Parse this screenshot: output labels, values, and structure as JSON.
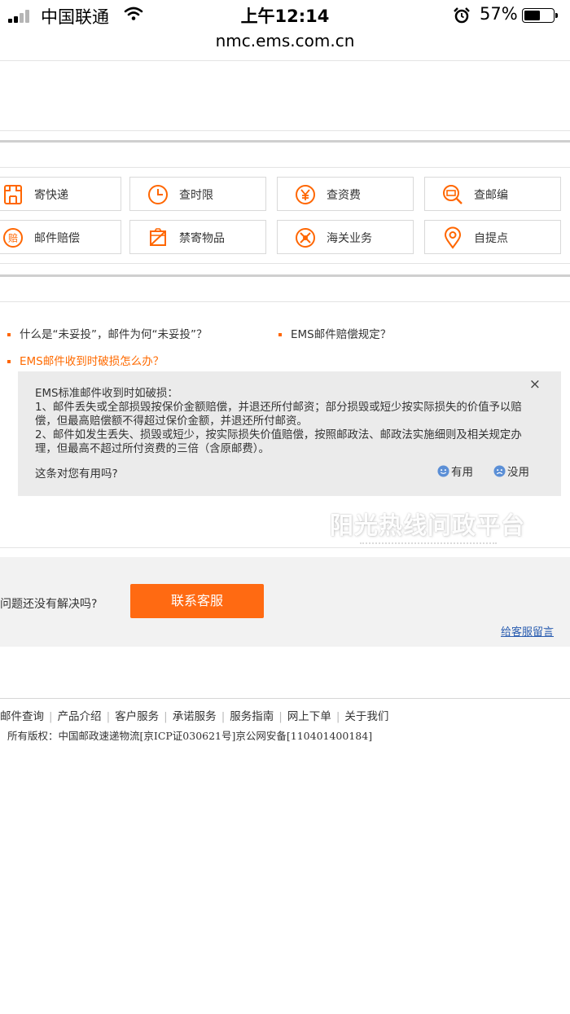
{
  "status_bar": {
    "carrier": "中国联通",
    "time": "上午12:14",
    "battery": "57%",
    "battery_level": 0.57
  },
  "browser": {
    "url": "nmc.ems.com.cn"
  },
  "services": [
    {
      "label": "寄快递",
      "icon": "package-icon"
    },
    {
      "label": "查时限",
      "icon": "clock-icon"
    },
    {
      "label": "查资费",
      "icon": "yen-icon"
    },
    {
      "label": "查邮编",
      "icon": "postcode-search-icon"
    },
    {
      "label": "邮件赔偿",
      "icon": "compensation-icon"
    },
    {
      "label": "禁寄物品",
      "icon": "prohibited-items-icon"
    },
    {
      "label": "海关业务",
      "icon": "customs-icon"
    },
    {
      "label": "自提点",
      "icon": "location-pin-icon"
    }
  ],
  "faq": {
    "items": [
      "什么是“未妥投”，邮件为何“未妥投”？",
      "EMS邮件赔偿规定？",
      "EMS邮件收到时破损怎么办？"
    ],
    "answer": {
      "lines": [
        "EMS标准邮件收到时如破损：",
        "1、邮件丢失或全部损毁按保价金额赔偿，并退还所付邮资；部分损毁或短少按实际损失的价值予以赔偿，但最高赔偿额不得超过保价金额，并退还所付邮资。",
        "2、邮件如发生丢失、损毁或短少，按实际损失价值赔偿，按照邮政法、邮政法实施细则及相关规定办理，但最高不超过所付资费的三倍（含原邮费）。"
      ],
      "close": "×",
      "helpful_question": "这条对您有用吗?",
      "yes": "有用",
      "no": "没用"
    }
  },
  "watermark": "阳光热线问政平台",
  "contact": {
    "question": "问题还没有解决吗?",
    "button": "联系客服",
    "message_link": "给客服留言"
  },
  "footer": {
    "links": [
      "邮件查询",
      "产品介绍",
      "客户服务",
      "承诺服务",
      "服务指南",
      "网上下单",
      "关于我们"
    ],
    "copyright": "所有版权：中国邮政速递物流[京ICP证030621号]京公网安备[110401400184]"
  },
  "colors": {
    "accent": "#ff6a12",
    "link": "#2a5db0"
  }
}
